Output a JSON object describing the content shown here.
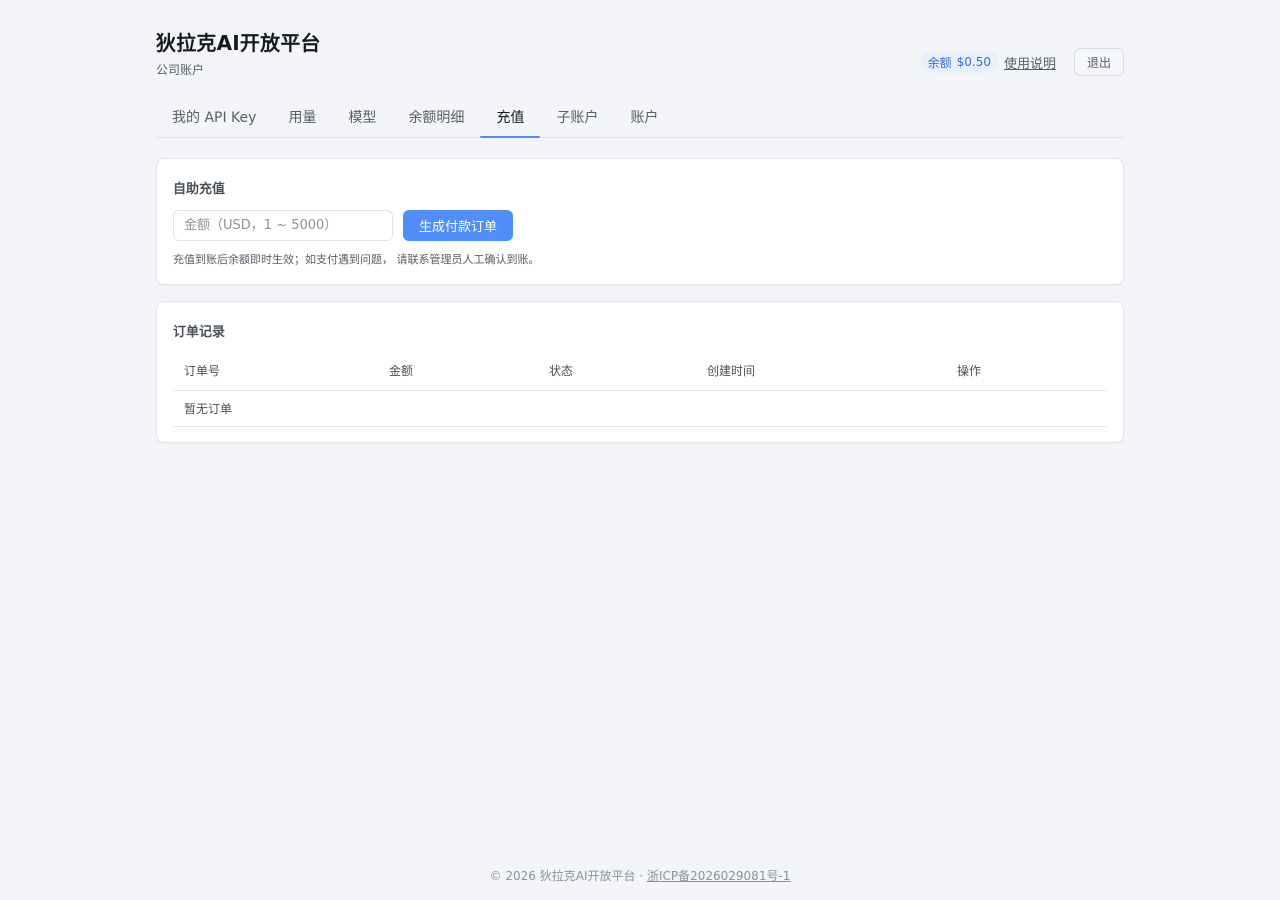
{
  "header": {
    "title": "狄拉克AI开放平台",
    "subtitle": "公司账户",
    "balance_label": "余额",
    "balance_value": "$0.50",
    "help_label": "使用说明",
    "logout_label": "退出"
  },
  "tabs": [
    {
      "label": "我的 API Key",
      "active": false
    },
    {
      "label": "用量",
      "active": false
    },
    {
      "label": "模型",
      "active": false
    },
    {
      "label": "余额明细",
      "active": false
    },
    {
      "label": "充值",
      "active": true
    },
    {
      "label": "子账户",
      "active": false
    },
    {
      "label": "账户",
      "active": false
    }
  ],
  "recharge": {
    "title": "自助充值",
    "amount_placeholder": "金额（USD，1 ~ 5000）",
    "amount_value": "",
    "create_order_label": "生成付款订单",
    "hint": "充值到账后余额即时生效；如支付遇到问题， 请联系管理员人工确认到账。"
  },
  "orders": {
    "title": "订单记录",
    "columns": [
      "订单号",
      "金额",
      "状态",
      "创建时间",
      "操作"
    ],
    "rows": [],
    "empty_text": "暂无订单"
  },
  "footer": {
    "copyright": "© 2026 狄拉克AI开放平台 · ",
    "icp": "浙ICP备2026029081号-1"
  },
  "colors": {
    "accent": "#4f8ff7",
    "background": "#f3f5f8",
    "badge_bg": "#e8f0fe",
    "badge_text": "#2f6fd1"
  }
}
